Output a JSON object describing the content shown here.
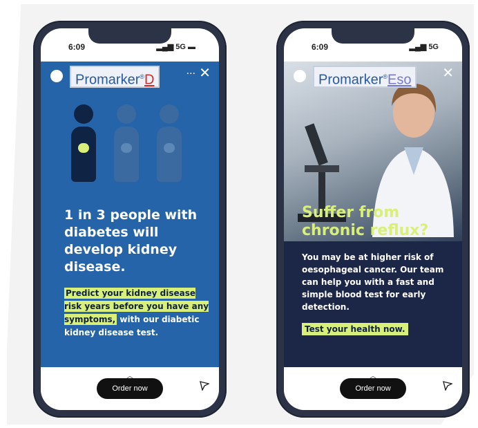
{
  "left_phone": {
    "status": {
      "time": "6:09",
      "signal": "5G"
    },
    "brand": {
      "name": "Promarker",
      "reg": "®",
      "suffix": "D"
    },
    "menu": "···",
    "close": "✕",
    "headline": "1 in 3 people with diabetes will develop kidney disease.",
    "highlight": "Predict your kidney disease risk years before you have any symptoms,",
    "subtext": " with our diabetic kidney disease test.",
    "cta": "Order now"
  },
  "right_phone": {
    "status": {
      "time": "6:09",
      "signal": "5G"
    },
    "brand": {
      "name": "Promarker",
      "reg": "®",
      "suffix": "Eso"
    },
    "close": "✕",
    "headline": "Suffer from chronic reflux?",
    "body": "You may be at higher risk of oesophageal cancer. Our team can help you with a fast and simple blood test for early detection.",
    "highlight": "Test your health now.",
    "cta": "Order now"
  },
  "colors": {
    "left_bg": "#2564a8",
    "right_bg": "#1c2748",
    "highlight": "#d8f07a",
    "phone": "#2d3346"
  },
  "icons": [
    "close-icon",
    "kebab-menu-icon",
    "send-icon",
    "chevron-up-icon",
    "person-icon",
    "kidney-icon"
  ]
}
